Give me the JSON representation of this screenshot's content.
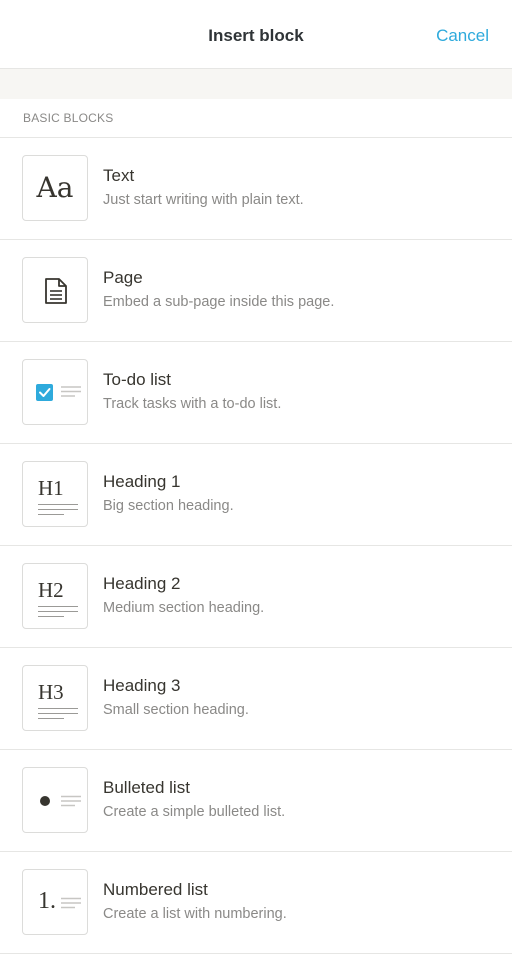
{
  "header": {
    "title": "Insert block",
    "cancel_label": "Cancel"
  },
  "colors": {
    "accent": "#2eaadc",
    "checkbox": "#2eaadc",
    "band": "#f7f6f3"
  },
  "section": {
    "label": "BASIC BLOCKS"
  },
  "blocks": [
    {
      "title": "Text",
      "description": "Just start writing with plain text.",
      "icon": "text-aa-icon"
    },
    {
      "title": "Page",
      "description": "Embed a sub-page inside this page.",
      "icon": "page-document-icon"
    },
    {
      "title": "To-do list",
      "description": "Track tasks with a to-do list.",
      "icon": "checkbox-list-icon"
    },
    {
      "title": "Heading 1",
      "description": "Big section heading.",
      "icon": "heading-1-icon",
      "icon_text": "H1"
    },
    {
      "title": "Heading 2",
      "description": "Medium section heading.",
      "icon": "heading-2-icon",
      "icon_text": "H2"
    },
    {
      "title": "Heading 3",
      "description": "Small section heading.",
      "icon": "heading-3-icon",
      "icon_text": "H3"
    },
    {
      "title": "Bulleted list",
      "description": "Create a simple bulleted list.",
      "icon": "bulleted-list-icon"
    },
    {
      "title": "Numbered list",
      "description": "Create a list with numbering.",
      "icon": "numbered-list-icon",
      "icon_text": "1."
    }
  ]
}
